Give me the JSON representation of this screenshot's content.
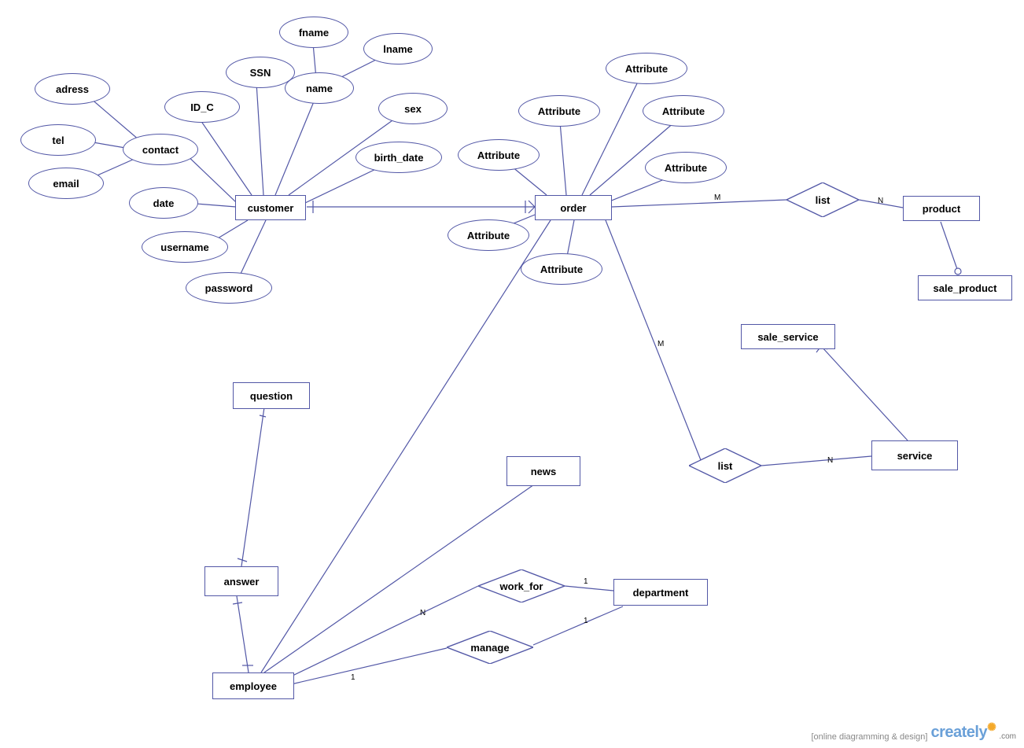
{
  "entities": {
    "customer": "customer",
    "order": "order",
    "product": "product",
    "sale_product": "sale_product",
    "service": "service",
    "sale_service": "sale_service",
    "question": "question",
    "answer": "answer",
    "news": "news",
    "employee": "employee",
    "department": "department"
  },
  "attributes": {
    "adress": "adress",
    "tel": "tel",
    "email": "email",
    "contact": "contact",
    "id_c": "ID_C",
    "ssn": "SSN",
    "name": "name",
    "fname": "fname",
    "lname": "lname",
    "sex": "sex",
    "birth_date": "birth_date",
    "date": "date",
    "username": "username",
    "password": "password",
    "attr1": "Attribute",
    "attr2": "Attribute",
    "attr3": "Attribute",
    "attr4": "Attribute",
    "attr5": "Attribute",
    "attr6": "Attribute"
  },
  "relationships": {
    "list1": "list",
    "list2": "list",
    "work_for": "work_for",
    "manage": "manage"
  },
  "cardinality": {
    "m1": "M",
    "m2": "M",
    "n1": "N",
    "n2": "N",
    "n3": "N",
    "one1": "1",
    "one2": "1",
    "one3": "1"
  },
  "footer": {
    "tagline": "[online diagramming & design]",
    "logo": "creately",
    "dotcom": ".com"
  }
}
